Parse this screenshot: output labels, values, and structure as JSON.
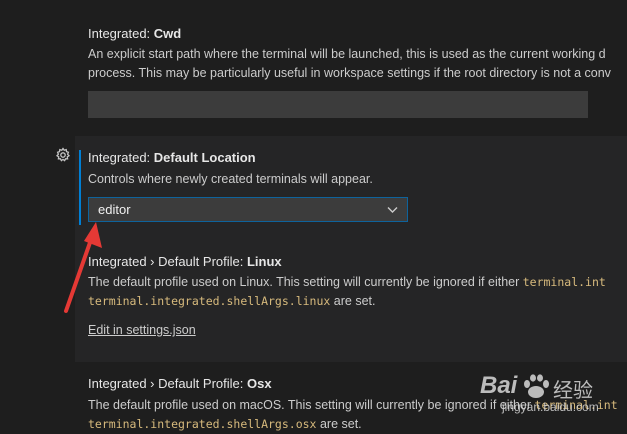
{
  "cwd": {
    "title_prefix": "Integrated: ",
    "title_name": "Cwd",
    "desc_line1": "An explicit start path where the terminal will be launched, this is used as the current working d",
    "desc_line2": "process. This may be particularly useful in workspace settings if the root directory is not a conv",
    "value": ""
  },
  "default_location": {
    "title_prefix": "Integrated: ",
    "title_name": "Default Location",
    "description": "Controls where newly created terminals will appear.",
    "selected": "editor"
  },
  "profile_linux": {
    "title_prefix": "Integrated › Default Profile: ",
    "title_name": "Linux",
    "desc_text": "The default profile used on Linux. This setting will currently be ignored if either ",
    "code1": "terminal.int",
    "code2": "terminal.integrated.shellArgs.linux",
    "desc_suffix": " are set.",
    "edit_link": "Edit in settings.json"
  },
  "profile_osx": {
    "title_prefix": "Integrated › Default Profile: ",
    "title_name": "Osx",
    "desc_text": "The default profile used on macOS. This setting will currently be ignored if either ",
    "code1": "terminal.int",
    "code2": "terminal.integrated.shellArgs.osx",
    "desc_suffix": " are set."
  },
  "watermark": {
    "brand": "Bai",
    "brand2": "经验",
    "url": "jingyan.baidu.com"
  },
  "colors": {
    "background": "#1e1e1e",
    "panel": "#252526",
    "focus": "#007fd4",
    "code": "#d7ba7d",
    "arrow": "#e53935"
  },
  "icons": {
    "gear": "gear-icon",
    "chevron": "chevron-down-icon",
    "arrow": "red-arrow-annotation"
  }
}
